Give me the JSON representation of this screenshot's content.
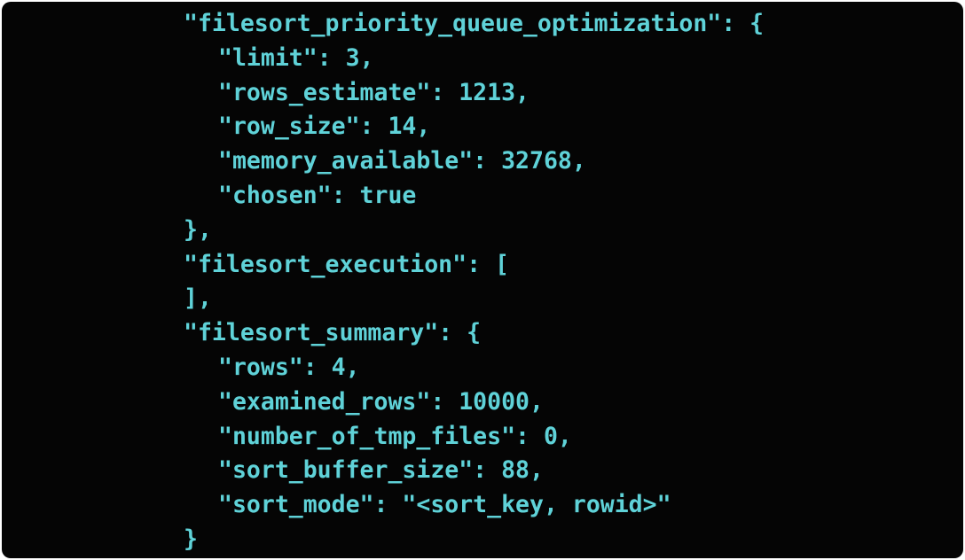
{
  "terminal": {
    "text_color": "#5fd2d8",
    "background": "#050505",
    "lines": [
      {
        "indent": 0,
        "text": "\"filesort_priority_queue_optimization\": {"
      },
      {
        "indent": 1,
        "text": "\"limit\": 3,"
      },
      {
        "indent": 1,
        "text": "\"rows_estimate\": 1213,"
      },
      {
        "indent": 1,
        "text": "\"row_size\": 14,"
      },
      {
        "indent": 1,
        "text": "\"memory_available\": 32768,"
      },
      {
        "indent": 1,
        "text": "\"chosen\": true"
      },
      {
        "indent": 0,
        "text": "},"
      },
      {
        "indent": 0,
        "text": "\"filesort_execution\": ["
      },
      {
        "indent": 0,
        "text": "],"
      },
      {
        "indent": 0,
        "text": "\"filesort_summary\": {"
      },
      {
        "indent": 1,
        "text": "\"rows\": 4,"
      },
      {
        "indent": 1,
        "text": "\"examined_rows\": 10000,"
      },
      {
        "indent": 1,
        "text": "\"number_of_tmp_files\": 0,"
      },
      {
        "indent": 1,
        "text": "\"sort_buffer_size\": 88,"
      },
      {
        "indent": 1,
        "text": "\"sort_mode\": \"<sort_key, rowid>\""
      },
      {
        "indent": 0,
        "text": "}"
      }
    ]
  }
}
